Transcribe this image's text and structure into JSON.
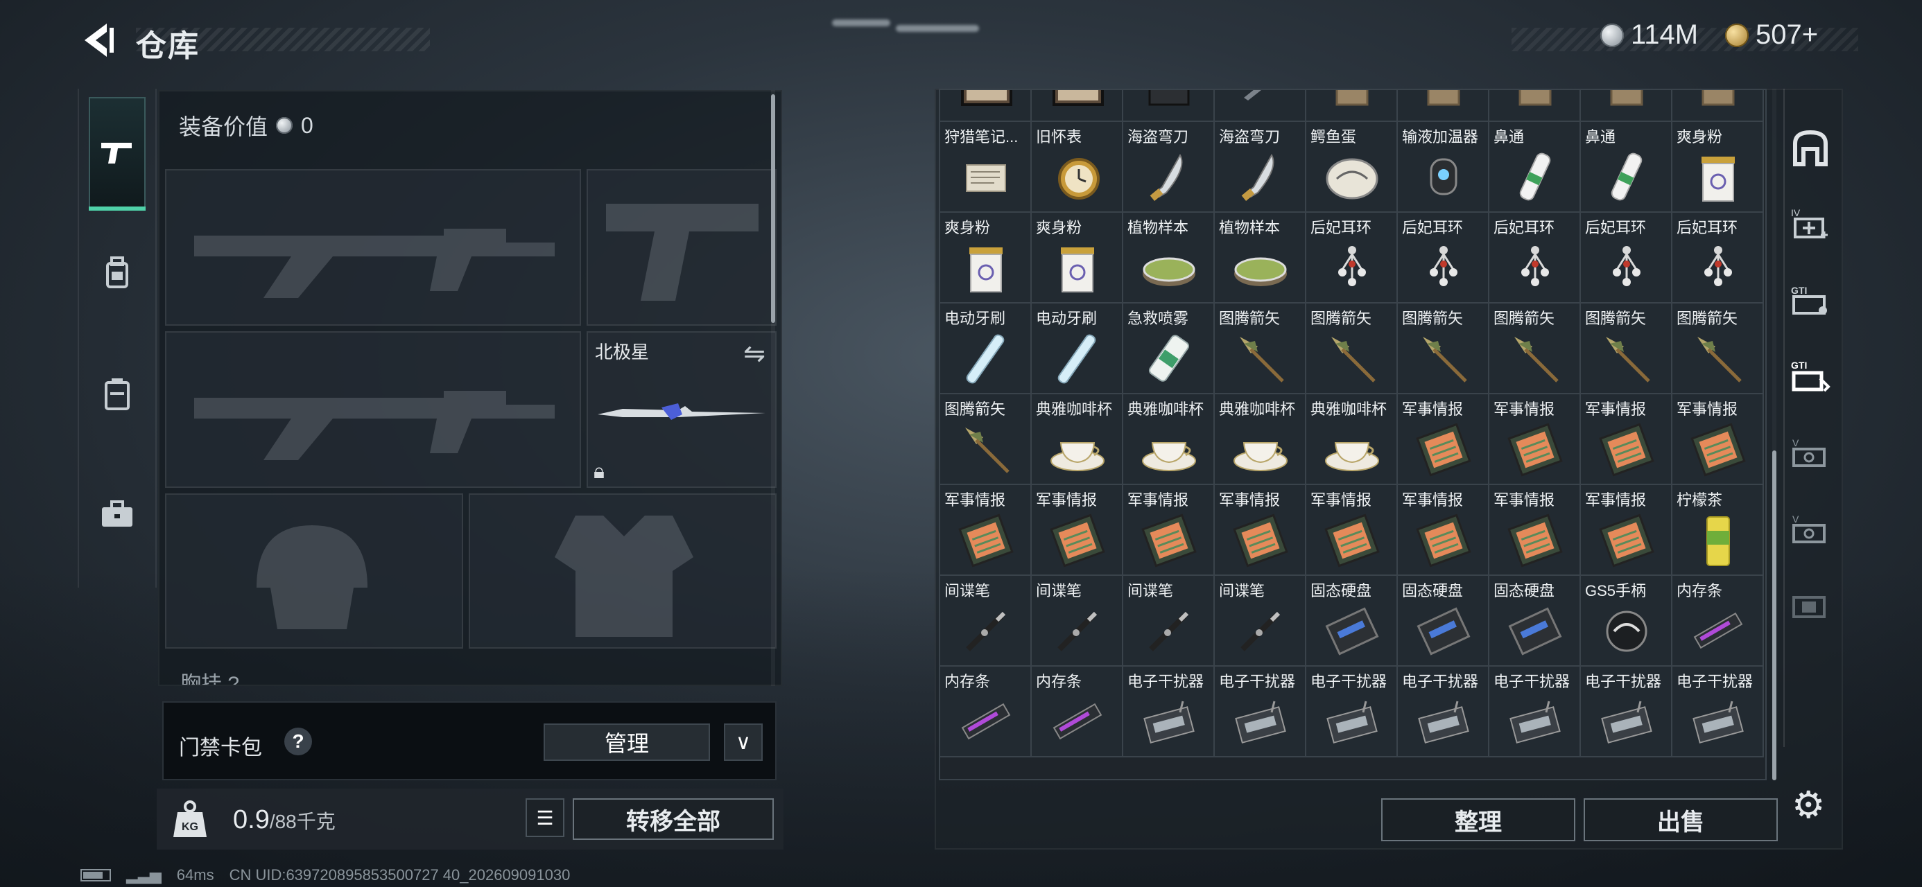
{
  "header": {
    "title": "仓库"
  },
  "currency": {
    "silver": "114M",
    "gold": "507+"
  },
  "equipment": {
    "value_label": "装备价值",
    "value": "0",
    "melee_slot_label": "北极星",
    "chest_label": "胸挂 ?"
  },
  "keycard": {
    "label": "门禁卡包",
    "help": "?",
    "manage": "管理",
    "dropdown": "∨"
  },
  "weight": {
    "current": "0.9",
    "capacity": "/88千克"
  },
  "actions": {
    "transfer_all": "转移全部",
    "sort": "整理",
    "sell": "出售"
  },
  "stash": {
    "rows": [
      [
        "",
        "",
        "",
        "",
        "",
        "",
        "",
        "",
        ""
      ],
      [
        "狩猎笔记...",
        "旧怀表",
        "海盗弯刀",
        "海盗弯刀",
        "鳄鱼蛋",
        "输液加温器",
        "鼻通",
        "鼻通",
        "爽身粉"
      ],
      [
        "爽身粉",
        "爽身粉",
        "植物样本",
        "植物样本",
        "后妃耳环",
        "后妃耳环",
        "后妃耳环",
        "后妃耳环",
        "后妃耳环"
      ],
      [
        "电动牙刷",
        "电动牙刷",
        "急救喷雾",
        "图腾箭矢",
        "图腾箭矢",
        "图腾箭矢",
        "图腾箭矢",
        "图腾箭矢",
        "图腾箭矢"
      ],
      [
        "图腾箭矢",
        "典雅咖啡杯",
        "典雅咖啡杯",
        "典雅咖啡杯",
        "典雅咖啡杯",
        "军事情报",
        "军事情报",
        "军事情报",
        "军事情报"
      ],
      [
        "军事情报",
        "军事情报",
        "军事情报",
        "军事情报",
        "军事情报",
        "军事情报",
        "军事情报",
        "军事情报",
        "柠檬茶"
      ],
      [
        "间谍笔",
        "间谍笔",
        "间谍笔",
        "间谍笔",
        "固态硬盘",
        "固态硬盘",
        "固态硬盘",
        "GS5手柄",
        "内存条"
      ],
      [
        "内存条",
        "内存条",
        "电子干扰器",
        "电子干扰器",
        "电子干扰器",
        "电子干扰器",
        "电子干扰器",
        "电子干扰器",
        "电子干扰器"
      ]
    ],
    "icons": [
      [
        "map",
        "map",
        "book",
        "knife",
        "box",
        "box",
        "box",
        "box",
        "box"
      ],
      [
        "note",
        "watch",
        "blade",
        "blade",
        "egg",
        "warmer",
        "tube",
        "tube",
        "jar"
      ],
      [
        "jar",
        "jar",
        "dish",
        "dish",
        "earring",
        "earring",
        "earring",
        "earring",
        "earring"
      ],
      [
        "brush",
        "brush",
        "spray",
        "arrow",
        "arrow",
        "arrow",
        "arrow",
        "arrow",
        "arrow"
      ],
      [
        "arrow",
        "cup",
        "cup",
        "cup",
        "cup",
        "intel",
        "intel",
        "intel",
        "intel"
      ],
      [
        "intel",
        "intel",
        "intel",
        "intel",
        "intel",
        "intel",
        "intel",
        "intel",
        "can"
      ],
      [
        "pen",
        "pen",
        "pen",
        "pen",
        "ssd",
        "ssd",
        "ssd",
        "grip",
        "ram"
      ],
      [
        "ram",
        "ram",
        "jammer",
        "jammer",
        "jammer",
        "jammer",
        "jammer",
        "jammer",
        "jammer"
      ]
    ]
  },
  "status": {
    "ping": "64ms",
    "uid": "CN UID:639720895853500727 40_202609091030"
  },
  "colors": {
    "accent": "#4fd1a8",
    "panel": "#222a31",
    "border": "#3a434b"
  }
}
